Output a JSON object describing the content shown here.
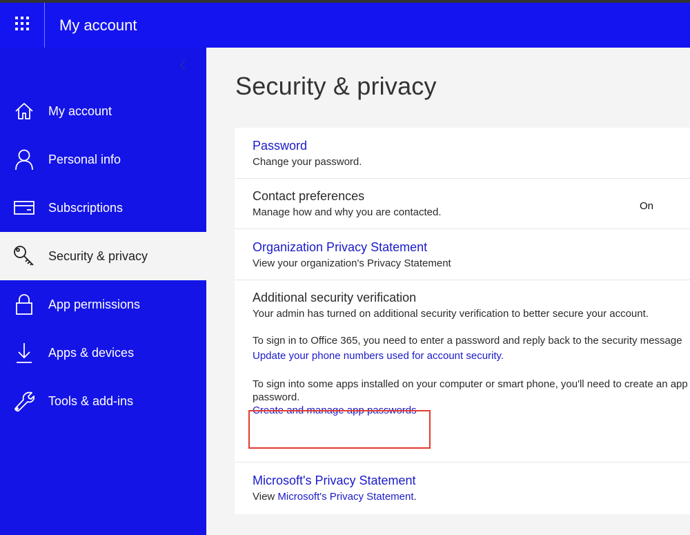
{
  "header": {
    "app_title": "My account",
    "waffle_icon": "app-launcher-icon",
    "background": "#1414f0"
  },
  "sidebar": {
    "background": "#1414e6",
    "collapse_icon": "chevron-left-icon",
    "items": [
      {
        "label": "My account",
        "icon": "home-icon",
        "active": false
      },
      {
        "label": "Personal info",
        "icon": "person-icon",
        "active": false
      },
      {
        "label": "Subscriptions",
        "icon": "credit-card-icon",
        "active": false
      },
      {
        "label": "Security & privacy",
        "icon": "key-icon",
        "active": true
      },
      {
        "label": "App permissions",
        "icon": "lock-icon",
        "active": false
      },
      {
        "label": "Apps & devices",
        "icon": "download-icon",
        "active": false
      },
      {
        "label": "Tools & add-ins",
        "icon": "wrench-icon",
        "active": false
      }
    ]
  },
  "main": {
    "title": "Security & privacy",
    "password": {
      "title": "Password",
      "desc": "Change your password."
    },
    "contact": {
      "title": "Contact preferences",
      "desc": "Manage how and why you are contacted.",
      "value": "On"
    },
    "org_privacy": {
      "title": "Organization Privacy Statement",
      "desc": "View your organization's Privacy Statement"
    },
    "asv": {
      "title": "Additional security verification",
      "desc": "Your admin has turned on additional security verification to better secure your account.",
      "sign_in_text": "To sign in to Office 365, you need to enter a password and reply back to the security message",
      "phone_link": "Update your phone numbers used for account security.",
      "apps_text_line1": "To sign into some apps installed on your computer or smart phone, you'll need to create an app",
      "apps_text_line2": "password.",
      "app_passwords_link": "Create and manage app passwords"
    },
    "ms_privacy": {
      "title": "Microsoft's Privacy Statement",
      "desc_prefix": "View ",
      "desc_link": "Microsoft's Privacy Statement",
      "desc_suffix": "."
    }
  },
  "colors": {
    "accent": "#1414f0",
    "link": "#1a1ac8",
    "highlight_box": "#e03a2e"
  }
}
